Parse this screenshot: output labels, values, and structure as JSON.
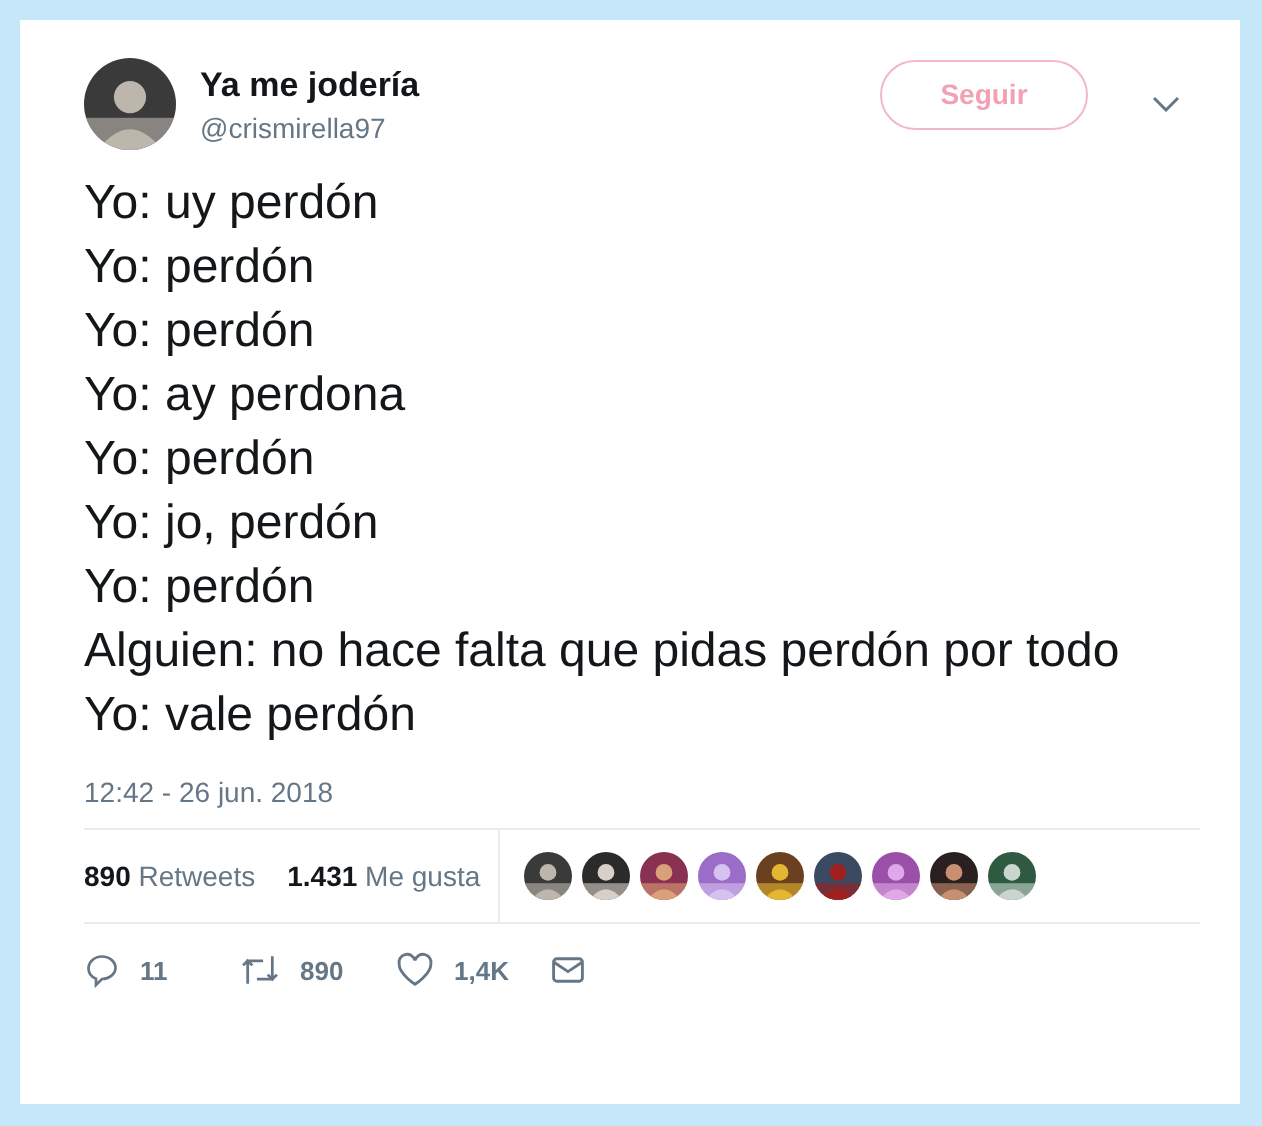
{
  "author": {
    "name": "Ya me jodería",
    "handle": "@crismirella97"
  },
  "follow_button": "Seguir",
  "lines": [
    "Yo: uy perdón",
    "Yo: perdón",
    "Yo: perdón",
    "Yo: ay perdona",
    "Yo: perdón",
    "Yo: jo, perdón",
    "Yo: perdón",
    "Alguien: no hace falta que pidas perdón por todo",
    "Yo: vale perdón"
  ],
  "timestamp": "12:42 - 26 jun. 2018",
  "stats": [
    {
      "count": "890",
      "label": "Retweets"
    },
    {
      "count": "1.431",
      "label": "Me gusta"
    }
  ],
  "actions": [
    {
      "kind": "reply",
      "count": "11"
    },
    {
      "kind": "retweet",
      "count": "890"
    },
    {
      "kind": "like",
      "count": "1,4K"
    },
    {
      "kind": "message"
    }
  ]
}
